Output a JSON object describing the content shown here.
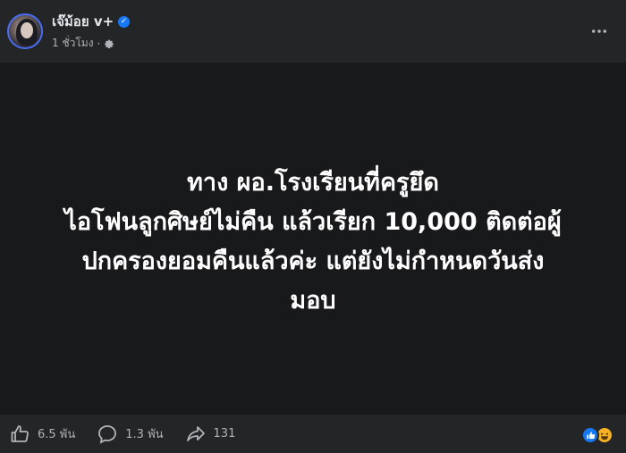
{
  "post": {
    "author": "เจ๊ม้อย v+",
    "time": "1 ชั่วโมง",
    "separator": "·",
    "content_lines": [
      "ทาง ผอ.โรงเรียนที่ครูยึด",
      "ไอโฟนลูกศิษย์ไม่คืน แล้วเรียก 10,000 ติดต่อผู้",
      "ปกครองยอมคืนแล้วค่ะ แต่ยังไม่กำหนดวันส่ง",
      "มอบ"
    ],
    "background_color": "#18191a"
  },
  "actions": {
    "like_count": "6.5 พัน",
    "comment_count": "1.3 พัน",
    "share_count": "131"
  },
  "icons": {
    "verified": "verified-badge-icon",
    "privacy": "gear-icon",
    "more": "more-options-icon",
    "like": "thumbs-up-icon",
    "comment": "comment-bubble-icon",
    "share": "share-arrow-icon",
    "reaction_like": "like-reaction-icon",
    "reaction_haha": "haha-reaction-icon"
  },
  "colors": {
    "accent": "#1877f2",
    "text": "#e4e6eb",
    "muted": "#b0b3b8"
  }
}
